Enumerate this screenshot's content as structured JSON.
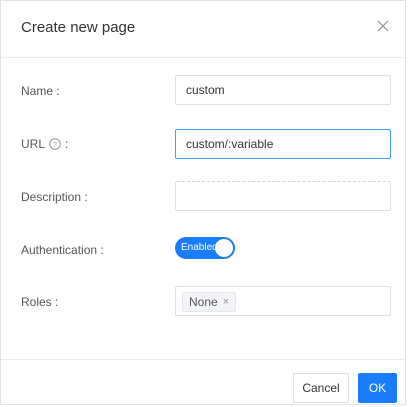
{
  "dialog": {
    "title": "Create new page",
    "close_label": "X"
  },
  "form": {
    "name": {
      "label": "Name :",
      "value": "custom"
    },
    "url": {
      "label": "URL",
      "suffix": ":",
      "value": "custom/:variable"
    },
    "description": {
      "label": "Description :",
      "value": ""
    },
    "authentication": {
      "label": "Authentication :",
      "state": "Enabled"
    },
    "roles": {
      "label": "Roles :",
      "tags": [
        "None"
      ]
    }
  },
  "footer": {
    "cancel": "Cancel",
    "ok": "OK"
  },
  "colors": {
    "primary": "#1a7dfb",
    "focus_border": "#409eff"
  }
}
